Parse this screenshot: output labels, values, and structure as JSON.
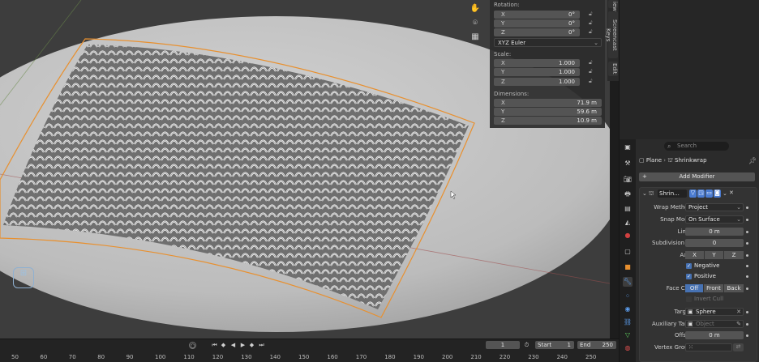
{
  "npanel": {
    "rotation_label": "Rotation:",
    "rotation": [
      {
        "axis": "X",
        "value": "0°"
      },
      {
        "axis": "Y",
        "value": "0°"
      },
      {
        "axis": "Z",
        "value": "0°"
      }
    ],
    "rotation_mode": "XYZ Euler",
    "scale_label": "Scale:",
    "scale": [
      {
        "axis": "X",
        "value": "1.000"
      },
      {
        "axis": "Y",
        "value": "1.000"
      },
      {
        "axis": "Z",
        "value": "1.000"
      }
    ],
    "dimensions_label": "Dimensions:",
    "dimensions": [
      {
        "axis": "X",
        "value": "71.9 m"
      },
      {
        "axis": "Y",
        "value": "59.6 m"
      },
      {
        "axis": "Z",
        "value": "10.9 m"
      }
    ]
  },
  "side_tabs": {
    "screencast": "Screencast Keys",
    "edit": "Edit",
    "view": "iew"
  },
  "props": {
    "search_placeholder": "Search",
    "breadcrumb_object": "Plane",
    "breadcrumb_modifier": "Shrinkwrap",
    "add_modifier": "Add Modifier",
    "modifier_name": "Shrin...",
    "wrap_method_label": "Wrap Method",
    "wrap_method": "Project",
    "snap_mode_label": "Snap Mode",
    "snap_mode": "On Surface",
    "limit_label": "Limit",
    "limit": "0 m",
    "subdivision_label": "Subdivision ...",
    "subdivision": "0",
    "axis_label": "Axis",
    "axis_x": "X",
    "axis_y": "Y",
    "axis_z": "Z",
    "negative": "Negative",
    "positive": "Positive",
    "face_cull_label": "Face Cull",
    "face_cull_off": "Off",
    "face_cull_front": "Front",
    "face_cull_back": "Back",
    "invert_cull": "Invert Cull",
    "target_label": "Target",
    "target": "Sphere",
    "aux_target_label": "Auxiliary Tar...",
    "aux_target_placeholder": "Object",
    "offset_label": "Offset",
    "offset": "0 m",
    "vertex_group_label": "Vertex Group"
  },
  "timeline": {
    "current_frame": "1",
    "start_label": "Start",
    "start": "1",
    "end_label": "End",
    "end": "250",
    "ticks": [
      "50",
      "60",
      "70",
      "80",
      "90",
      "100",
      "110",
      "120",
      "130",
      "140",
      "150",
      "160",
      "170",
      "180",
      "190",
      "200",
      "210",
      "220",
      "230",
      "240",
      "250"
    ]
  },
  "colors": {
    "accent": "#4772b3",
    "selection_outline": "#e8902f",
    "active_modifier_icon": "#4a7bd0"
  }
}
